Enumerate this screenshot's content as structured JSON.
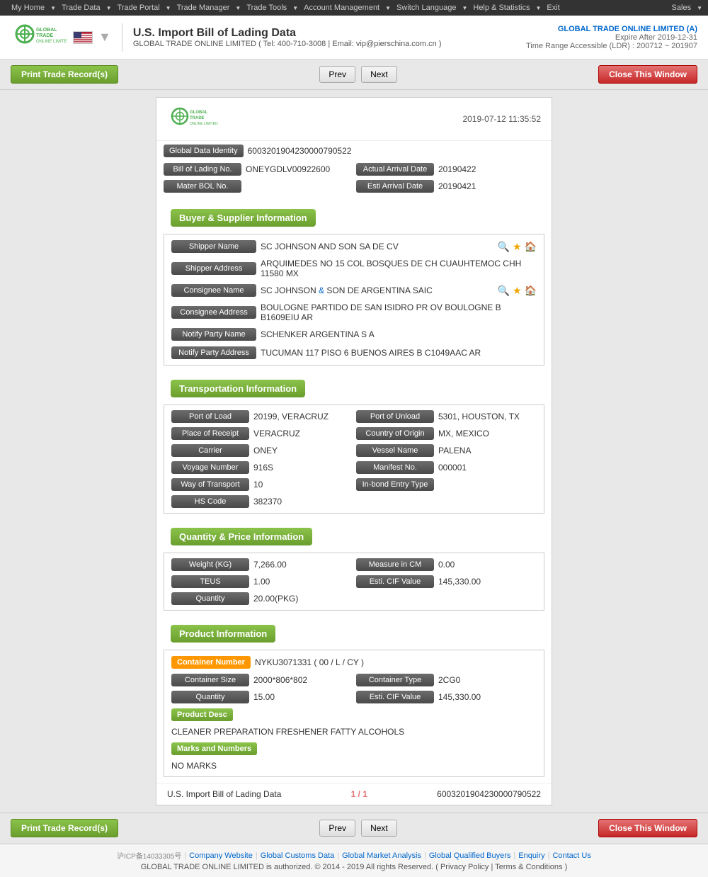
{
  "nav": {
    "items": [
      {
        "label": "My Home",
        "caret": true
      },
      {
        "label": "Trade Data",
        "caret": true
      },
      {
        "label": "Trade Portal",
        "caret": true
      },
      {
        "label": "Trade Manager",
        "caret": true
      },
      {
        "label": "Trade Tools",
        "caret": true
      },
      {
        "label": "Account Management",
        "caret": true
      },
      {
        "label": "Switch Language",
        "caret": true
      },
      {
        "label": "Help & Statistics",
        "caret": true
      },
      {
        "label": "Exit",
        "caret": false
      }
    ],
    "sales": "Sales"
  },
  "header": {
    "title": "U.S. Import Bill of Lading Data",
    "sub": "GLOBAL TRADE ONLINE LIMITED ( Tel: 400-710-3008 | Email: vip@pierschina.com.cn )",
    "company": "GLOBAL TRADE ONLINE LIMITED (A)",
    "expire": "Expire After 2019-12-31",
    "ldr": "Time Range Accessible (LDR) : 200712 ~ 201907"
  },
  "toolbar": {
    "print_label": "Print Trade Record(s)",
    "prev_label": "Prev",
    "next_label": "Next",
    "close_label": "Close This Window"
  },
  "record": {
    "timestamp": "2019-07-12 11:35:52",
    "global_data_identity_label": "Global Data Identity",
    "global_data_identity_value": "6003201904230000790522",
    "bol_no_label": "Bill of Lading No.",
    "bol_no_value": "ONEYGDLV00922600",
    "actual_arrival_label": "Actual Arrival Date",
    "actual_arrival_value": "20190422",
    "mater_bol_label": "Mater BOL No.",
    "esti_arrival_label": "Esti Arrival Date",
    "esti_arrival_value": "20190421"
  },
  "buyer_supplier": {
    "section_title": "Buyer & Supplier Information",
    "shipper_name_label": "Shipper Name",
    "shipper_name_value": "SC JOHNSON AND SON SA DE CV",
    "shipper_address_label": "Shipper Address",
    "shipper_address_value": "ARQUIMEDES NO 15 COL BOSQUES DE CH CUAUHTEMOC CHH 11580 MX",
    "consignee_name_label": "Consignee Name",
    "consignee_name_value": "SC JOHNSON & SON DE ARGENTINA SAIC",
    "consignee_address_label": "Consignee Address",
    "consignee_address_value": "BOULOGNE PARTIDO DE SAN ISIDRO PR OV BOULOGNE B B1609EIU AR",
    "notify_party_name_label": "Notify Party Name",
    "notify_party_name_value": "SCHENKER ARGENTINA S A",
    "notify_party_address_label": "Notify Party Address",
    "notify_party_address_value": "TUCUMAN 117 PISO 6 BUENOS AIRES B C1049AAC AR"
  },
  "transportation": {
    "section_title": "Transportation Information",
    "port_of_load_label": "Port of Load",
    "port_of_load_value": "20199, VERACRUZ",
    "port_of_unload_label": "Port of Unload",
    "port_of_unload_value": "5301, HOUSTON, TX",
    "place_of_receipt_label": "Place of Receipt",
    "place_of_receipt_value": "VERACRUZ",
    "country_of_origin_label": "Country of Origin",
    "country_of_origin_value": "MX, MEXICO",
    "carrier_label": "Carrier",
    "carrier_value": "ONEY",
    "vessel_name_label": "Vessel Name",
    "vessel_name_value": "PALENA",
    "voyage_number_label": "Voyage Number",
    "voyage_number_value": "916S",
    "manifest_no_label": "Manifest No.",
    "manifest_no_value": "000001",
    "way_of_transport_label": "Way of Transport",
    "way_of_transport_value": "10",
    "in_bond_entry_label": "In-bond Entry Type",
    "in_bond_entry_value": "",
    "hs_code_label": "HS Code",
    "hs_code_value": "382370"
  },
  "quantity_price": {
    "section_title": "Quantity & Price Information",
    "weight_label": "Weight (KG)",
    "weight_value": "7,266.00",
    "measure_cm_label": "Measure in CM",
    "measure_cm_value": "0.00",
    "teus_label": "TEUS",
    "teus_value": "1.00",
    "esti_cif_label": "Esti. CIF Value",
    "esti_cif_value": "145,330.00",
    "quantity_label": "Quantity",
    "quantity_value": "20.00(PKG)"
  },
  "product": {
    "section_title": "Product Information",
    "container_number_label": "Container Number",
    "container_number_value": "NYKU3071331 ( 00 / L / CY )",
    "container_size_label": "Container Size",
    "container_size_value": "2000*806*802",
    "container_type_label": "Container Type",
    "container_type_value": "2CG0",
    "quantity_label": "Quantity",
    "quantity_value": "15.00",
    "esti_cif_label": "Esti. CIF Value",
    "esti_cif_value": "145,330.00",
    "product_desc_label": "Product Desc",
    "product_desc_value": "CLEANER PREPARATION FRESHENER FATTY ALCOHOLS",
    "marks_label": "Marks and Numbers",
    "marks_value": "NO MARKS"
  },
  "record_footer": {
    "left_label": "U.S. Import Bill of Lading Data",
    "page": "1 / 1",
    "id": "6003201904230000790522"
  },
  "footer": {
    "icp": "沪ICP备14033305号",
    "links": [
      "Company Website",
      "Global Customs Data",
      "Global Market Analysis",
      "Global Qualified Buyers",
      "Enquiry",
      "Contact Us"
    ],
    "copyright": "GLOBAL TRADE ONLINE LIMITED is authorized. © 2014 - 2019 All rights Reserved.  (  Privacy Policy  |  Terms & Conditions  )"
  }
}
